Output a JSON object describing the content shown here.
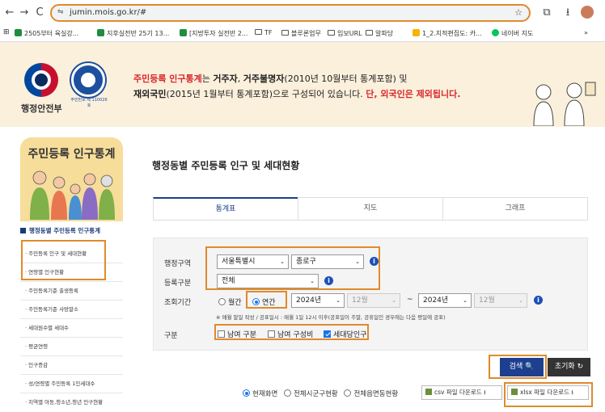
{
  "browser": {
    "url": "jumin.mois.go.kr/#",
    "bookmarks": [
      "2505부터 육실강...",
      "지후실전반 25기 13...",
      "[지방투자 실전반 2...",
      "TF",
      "블루론업무",
      "임보URL",
      "알파당",
      "1_2.지적편집도: 카...",
      "네이버 지도"
    ]
  },
  "banner": {
    "ministry": "행정안전부",
    "seal_label": "주민번호 제 110026 호",
    "line1_pre": "",
    "line1_red": "주민등록 인구통계",
    "line1_mid": "는 ",
    "line1_b1": "거주자",
    "line1_c": ", ",
    "line1_b2": "거주불명자",
    "line1_post": "(2010년 10월부터 통계포함) 및",
    "line2_b": "재외국민",
    "line2_post": "(2015년 1월부터 통계포함)으로 구성되어 있습니다. ",
    "line2_red": "단, 외국인은 제외됩니다."
  },
  "sidebar": {
    "title": "주민등록 인구통계",
    "heading": "행정동별 주민등록 인구통계",
    "items": [
      "· 주민등록 인구 및 세대현황",
      "· 연령별 인구현황",
      "· 주민등록기준 출생등록",
      "· 주민등록기준 사망말소",
      "· 세대원수별 세대수",
      "· 평균연령",
      "· 인구증감",
      "· 성/연령별 주민등록 1인세대수",
      "· 지역별 아동,청소년,청년 인구현황"
    ]
  },
  "main": {
    "title": "행정동별 주민등록 인구 및 세대현황",
    "tabs": [
      "통계표",
      "지도",
      "그래프"
    ],
    "form": {
      "region_label": "행정구역",
      "region_sido": "서울특별시",
      "region_sigungu": "종로구",
      "reg_label": "등록구분",
      "reg_value": "전체",
      "period_label": "조회기간",
      "period_monthly": "월간",
      "period_yearly": "연간",
      "from_year": "2024년",
      "from_month": "12월",
      "tilde": "~",
      "to_year": "2024년",
      "to_month": "12월",
      "note": "※ 매월 말일 작성 / 공표일시 : 매월 1일 12시 이후(공표일이 주말, 공휴일인 경우에는 다음 평일에 공표)",
      "gubun_label": "구분",
      "chk1": "남여 구분",
      "chk2": "남여 구성비",
      "chk3": "세대당인구"
    },
    "search_btn": "검색 🔍",
    "reset_btn": "초기화 ↻",
    "scope": {
      "opt1": "현재화면",
      "opt2": "전체시군구현황",
      "opt3": "전체읍면동현황"
    },
    "csv_btn": "csv 파일 다운로드 ⭳",
    "xlsx_btn": "xlsx 파일 다운로드 ⭳"
  }
}
